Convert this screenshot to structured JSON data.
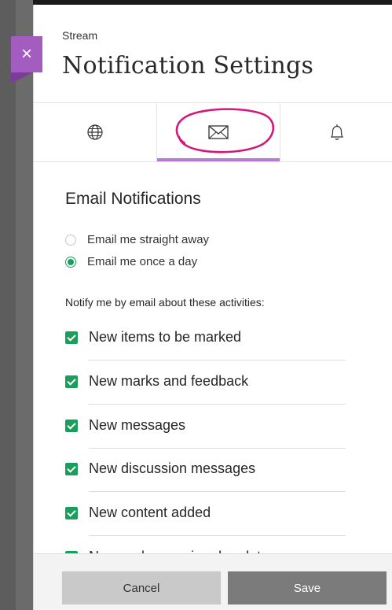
{
  "panel": {
    "eyebrow": "Stream",
    "title": "Notification Settings",
    "close_label": "×"
  },
  "tabs": [
    {
      "icon": "globe-icon",
      "active": false
    },
    {
      "icon": "envelope-icon",
      "active": true
    },
    {
      "icon": "bell-icon",
      "active": false
    }
  ],
  "email": {
    "section_title": "Email Notifications",
    "frequency_options": [
      {
        "label": "Email me straight away",
        "selected": false
      },
      {
        "label": "Email me once a day",
        "selected": true
      }
    ],
    "activities_label": "Notify me by email about these activities:",
    "activities": [
      {
        "label": "New items to be marked",
        "checked": true
      },
      {
        "label": "New marks and feedback",
        "checked": true
      },
      {
        "label": "New messages",
        "checked": true
      },
      {
        "label": "New discussion messages",
        "checked": true
      },
      {
        "label": "New content added",
        "checked": true
      },
      {
        "label": "New and upcoming due dates",
        "checked": true
      }
    ]
  },
  "footer": {
    "cancel_label": "Cancel",
    "save_label": "Save"
  },
  "colors": {
    "accent_purple": "#a35dc1",
    "tab_active_underline": "#b77bd6",
    "check_green": "#1a9e5c",
    "annotation_magenta": "#d4177a"
  }
}
